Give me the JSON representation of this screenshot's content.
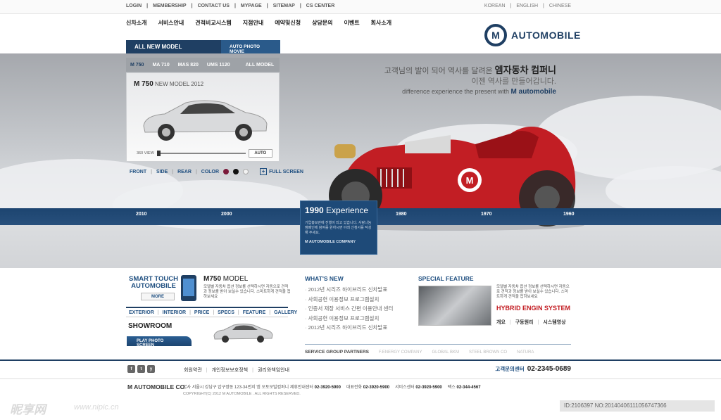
{
  "util": {
    "left": [
      "LOGIN",
      "MEMBERSHIP",
      "CONTACT US",
      "MYPAGE",
      "SITEMAP",
      "CS CENTER"
    ],
    "right": [
      "KOREAN",
      "ENGLISH",
      "CHINESE"
    ]
  },
  "gnb": [
    "신차소개",
    "서비스안내",
    "견적비교시스템",
    "지점안내",
    "예약및신청",
    "상담문의",
    "이벤트",
    "회사소개"
  ],
  "logo": {
    "mark": "M",
    "text": "AUTOMOBILE"
  },
  "tabs": {
    "main": "ALL NEW MODEL",
    "sub": "AUTO PHOTO MOVIE"
  },
  "models": [
    "M 750",
    "MA 710",
    "MAS 820",
    "UMS 1120",
    "ALL MODEL"
  ],
  "model_card": {
    "name": "M 750",
    "subtitle": "NEW MODEL 2012",
    "view_label": "360 VIEW",
    "auto_label": "AUTO"
  },
  "view_options": {
    "front": "FRONT",
    "side": "SIDE",
    "rear": "REAR",
    "color": "COLOR",
    "fullscreen": "FULL SCREEN"
  },
  "swatch_colors": [
    "#7a1a3a",
    "#111111",
    "#f2f2f2"
  ],
  "slogan": {
    "line1_pre": "고객님의 발이 되어 역사를 달려온",
    "line1_bold": "엠자동차 컴퍼니",
    "line2": "이젠 역사를 만들어갑니다.",
    "line3_pre": "difference experience the present with",
    "line3_bold": "M automobile"
  },
  "timeline_years": [
    "2010",
    "2000",
    "1980",
    "1970",
    "1960"
  ],
  "experience": {
    "year": "1990",
    "title": "Experience",
    "desc": "기업홍보관에 진행이 되고 있습니다. 사랑나눔캠페인에 참여를 원하시면 아래 신청서를 작성해 주세요.",
    "footer": "M AUTOMOBILE COMPANY"
  },
  "smart_touch": {
    "title1": "SMART TOUCH",
    "title2": "AUTOMOBILE",
    "more": "MORE"
  },
  "m750": {
    "name_bold": "M750",
    "name_rest": "MODEL",
    "desc": "모델별 자동차 옵션 정보를 선택하시면 자동으로 견적과 정보를 받아 보실수 있습니다. 스마트하게 견적을 접하보세요"
  },
  "spec_nav": [
    "EXTERIOR",
    "INTERIOR",
    "PRICE",
    "SPECS",
    "FEATURE",
    "GALLERY"
  ],
  "showroom": {
    "title": "SHOWROOM",
    "button": "PLAY PHOTO SCREEN"
  },
  "whats_new": {
    "title": "WHAT'S NEW",
    "items": [
      "2012년 시리즈 하이브리드 신차발표",
      "사회공헌 이용정보 프로그램설치",
      "인증서 재장 서비스 간편 이용안내 센터",
      "사회공헌 이용정보 프로그램설치",
      "2012년 시리즈 하이브리드 신차발표"
    ]
  },
  "special": {
    "title": "SPECIAL FEATURE",
    "desc": "모델별 자동차 옵션 정보를 선택하시면 자동으로 견적과 정보를 받아 보실수 있습니다. 스마트하게 견적을 접하보세요",
    "headline": "HYBRID ENGIN SYSTEM",
    "links": [
      "개요",
      "구동원리",
      "시스템영상"
    ]
  },
  "partners": {
    "label": "SERVICE GROUP PARTNERS",
    "items": [
      "F.ENERGY COMPANY",
      "GLOBAL BKM",
      "STEEL BROWN CO",
      "NATURA"
    ]
  },
  "footer": {
    "sns": [
      "f",
      "t",
      "y"
    ],
    "links": [
      "회원약관",
      "개인정보보호정책",
      "권리와책임안내"
    ],
    "cs_label": "고객문의센터",
    "cs_phone": "02-2345-0689",
    "company": "M AUTOMOBILE CO",
    "addr": "본사 서울시 강남구 압구정동 123-34번지 엠 오토모빌컴퍼니",
    "tel_label": "제휴안내센터",
    "tel": "02-3920-5900",
    "rep_label": "대표전화",
    "rep": "02-3920-5900",
    "svc_label": "서비스센터",
    "svc": "02-3920-5900",
    "fax_label": "팩스",
    "fax": "02-344-4567",
    "copyright": "COPYRIGHT(C) 2012 M AUTOMOBILE . ALL RIGHTS RESERVED."
  },
  "watermark": {
    "brand": "昵享网",
    "url": "www.nipic.cn",
    "id": "ID:2106397 NO:20140406111056747366"
  }
}
